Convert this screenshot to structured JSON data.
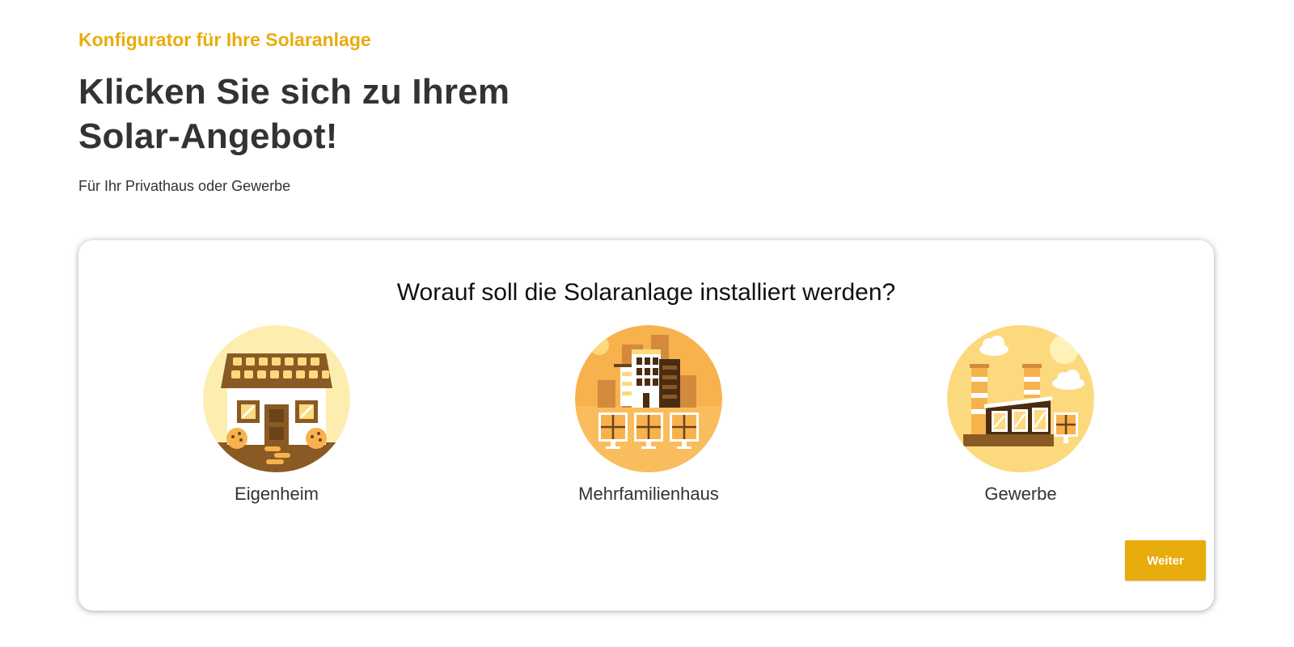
{
  "header": {
    "eyebrow": "Konfigurator für Ihre Solaranlage",
    "headline_line1": "Klicken Sie sich zu Ihrem",
    "headline_line2": "Solar-Angebot!",
    "subline": "Für Ihr Privathaus oder Gewerbe"
  },
  "card": {
    "question": "Worauf soll die Solaranlage installiert werden?",
    "options": [
      {
        "label": "Eigenheim",
        "icon": "house-illustration"
      },
      {
        "label": "Mehrfamilienhaus",
        "icon": "apartment-building-illustration"
      },
      {
        "label": "Gewerbe",
        "icon": "factory-illustration"
      }
    ],
    "next_label": "Weiter"
  },
  "colors": {
    "accent": "#e8ac0c",
    "text": "#333333",
    "illustration_light": "#fdeeb0",
    "illustration_orange": "#f7b24e",
    "illustration_yellow": "#fdd97e",
    "illustration_brown": "#8a5a24"
  }
}
